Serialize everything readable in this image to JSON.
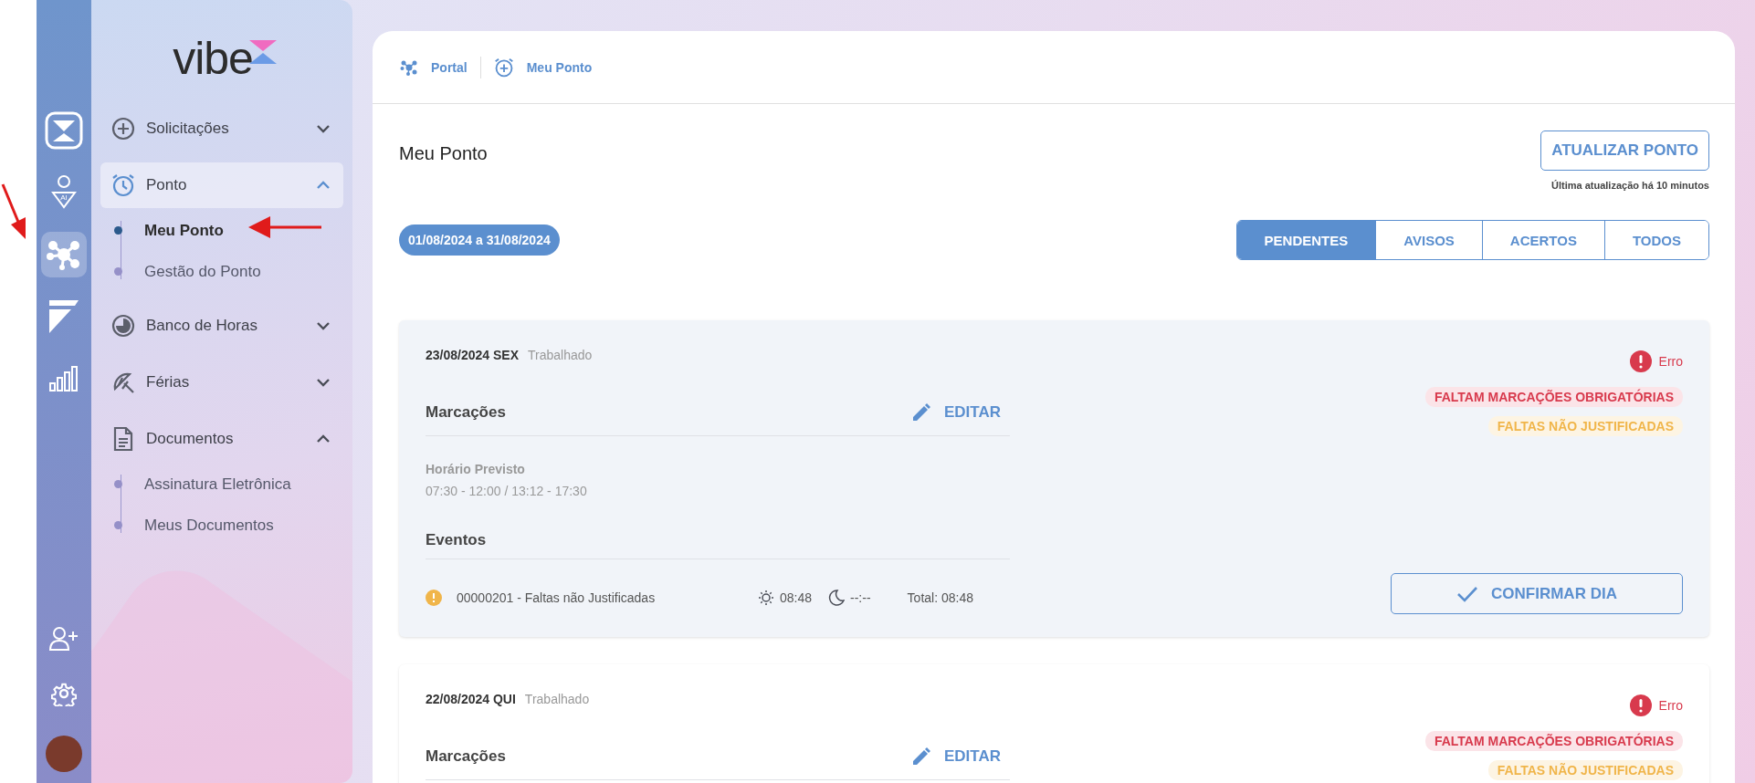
{
  "rail": [
    {
      "kind": "logo",
      "selected": false
    },
    {
      "kind": "ai-user",
      "selected": false,
      "badge": "AI"
    },
    {
      "kind": "hub",
      "selected": true
    },
    {
      "kind": "flag",
      "selected": false
    },
    {
      "kind": "chart",
      "selected": false
    }
  ],
  "rail_bottom": [
    {
      "kind": "add-user"
    },
    {
      "kind": "gear"
    },
    {
      "kind": "avatar"
    }
  ],
  "sidebar": {
    "logo": "vibe",
    "menu": [
      {
        "label": "Solicitações",
        "kind": "plus",
        "expanded": false,
        "selected": false
      },
      {
        "label": "Ponto",
        "kind": "alarm",
        "expanded": true,
        "selected": true,
        "children": [
          {
            "label": "Meu Ponto",
            "selected": true
          },
          {
            "label": "Gestão do Ponto",
            "selected": false
          }
        ]
      },
      {
        "label": "Banco de Horas",
        "kind": "pie",
        "expanded": false,
        "selected": false
      },
      {
        "label": "Férias",
        "kind": "umbrella",
        "expanded": false,
        "selected": false
      },
      {
        "label": "Documentos",
        "kind": "document",
        "expanded": true,
        "selected": false,
        "children": [
          {
            "label": "Assinatura Eletrônica",
            "selected": false
          },
          {
            "label": "Meus Documentos",
            "selected": false
          }
        ]
      }
    ]
  },
  "breadcrumb": [
    {
      "label": "Portal",
      "kind": "hub"
    },
    {
      "label": "Meu Ponto",
      "kind": "alarm"
    }
  ],
  "page_title": "Meu Ponto",
  "refresh_button": "ATUALIZAR PONTO",
  "last_update": "Última atualização há 10 minutos",
  "period": "01/08/2024 a 31/08/2024",
  "filters": [
    {
      "label": "PENDENTES",
      "selected": true
    },
    {
      "label": "AVISOS",
      "selected": false
    },
    {
      "label": "ACERTOS",
      "selected": false
    },
    {
      "label": "TODOS",
      "selected": false
    }
  ],
  "days": [
    {
      "date": "23/08/2024 SEX",
      "status": "Trabalhado",
      "marks_label": "Marcações",
      "edit_label": "EDITAR",
      "schedule_label": "Horário Previsto",
      "schedule": "07:30 - 12:00 / 13:12 - 17:30",
      "events_label": "Eventos",
      "events": [
        {
          "description": "00000201 - Faltas não Justificadas",
          "day": "08:48",
          "night": "--:--",
          "total": "Total: 08:48"
        }
      ],
      "alert": "Erro",
      "tags": [
        {
          "label": "FALTAM MARCAÇÕES OBRIGATÓRIAS",
          "kind": "error"
        },
        {
          "label": "FALTAS NÃO JUSTIFICADAS",
          "kind": "warning"
        }
      ],
      "confirm_button": "CONFIRMAR DIA"
    },
    {
      "date": "22/08/2024 QUI",
      "status": "Trabalhado",
      "marks_label": "Marcações",
      "edit_label": "EDITAR",
      "alert": "Erro",
      "tags": [
        {
          "label": "FALTAM MARCAÇÕES OBRIGATÓRIAS",
          "kind": "error"
        },
        {
          "label": "FALTAS NÃO JUSTIFICADAS",
          "kind": "warning"
        }
      ]
    }
  ]
}
